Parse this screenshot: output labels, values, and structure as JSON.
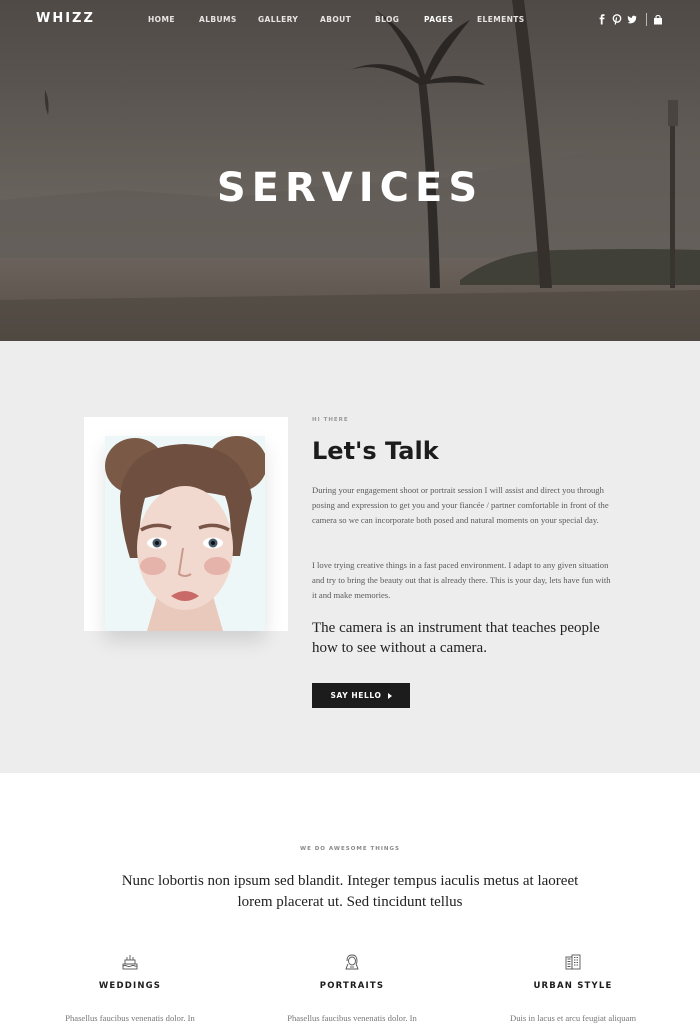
{
  "brand": {
    "logo": "WHIZZ"
  },
  "nav": {
    "items": [
      {
        "label": "HOME"
      },
      {
        "label": "ALBUMS"
      },
      {
        "label": "GALLERY"
      },
      {
        "label": "ABOUT"
      },
      {
        "label": "BLOG"
      },
      {
        "label": "PAGES",
        "active": true
      },
      {
        "label": "ELEMENTS"
      }
    ],
    "social": [
      "facebook-icon",
      "pinterest-icon",
      "twitter-icon",
      "shopping-bag-icon"
    ]
  },
  "hero": {
    "title": "SERVICES"
  },
  "about": {
    "eyebrow": "HI THERE",
    "heading": "Let's Talk",
    "paragraph1": "During your engagement shoot or portrait session I will assist and direct you through posing and expression to get you and your fiancée / partner comfortable in front of the camera so we can incorporate both posed and natural moments on your special day.",
    "paragraph2": "I love trying creative things in a fast paced environment. I adapt to any given situation and try to bring the beauty out that is already there. This is your day, lets have fun with it and make memories.",
    "quote": "The camera is an instrument that teaches people how to see without a camera.",
    "cta_label": "SAY HELLO"
  },
  "services": {
    "eyebrow": "WE DO AWESOME THINGS",
    "lead": "Nunc lobortis non ipsum sed blandit. Integer tempus iaculis metus at laoreet lorem placerat ut. Sed tincidunt tellus",
    "items": [
      {
        "icon": "cake-icon",
        "title": "WEDDINGS",
        "text": "Phasellus faucibus venenatis dolor. In"
      },
      {
        "icon": "portrait-icon",
        "title": "PORTRAITS",
        "text": "Phasellus faucibus venenatis dolor. In"
      },
      {
        "icon": "building-icon",
        "title": "URBAN STYLE",
        "text": "Duis in lacus et arcu feugiat aliquam"
      }
    ]
  },
  "colors": {
    "accent": "#1c1c1c",
    "section_bg": "#ededed",
    "hero_overlay": "#56514d"
  }
}
